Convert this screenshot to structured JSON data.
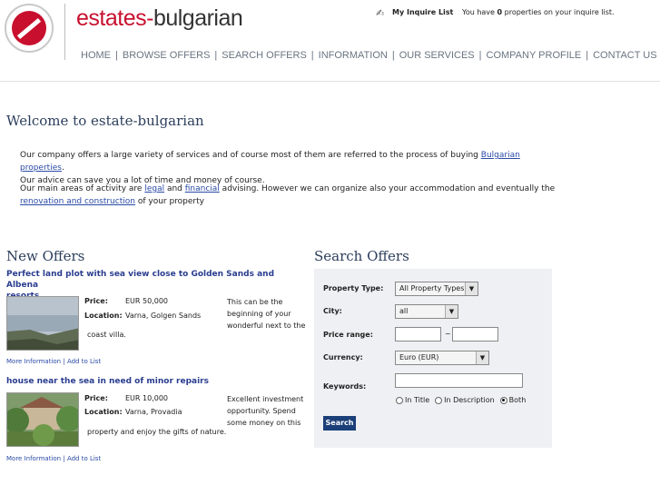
{
  "header": {
    "brand_part1": "estates-",
    "brand_part2": "bulgarian",
    "inquire_label": "My Inquire List",
    "inquire_text_before": "You have ",
    "inquire_count": "0",
    "inquire_text_after": " properties on your inquire list."
  },
  "nav": [
    "HOME",
    "BROWSE OFFERS",
    "SEARCH OFFERS",
    "INFORMATION",
    "OUR SERVICES",
    "COMPANY PROFILE",
    "CONTACT US"
  ],
  "welcome": {
    "title": "Welcome to estate-bulgarian",
    "p1_before": "Our company offers a large variety of services and of course most of them are referred to the process of buying ",
    "p1_link": "Bulgarian properties",
    "p1_after": ".",
    "p1_line2": "Our advice can save you a lot of time and money of course.",
    "p2_a": "Our main areas of activity are ",
    "p2_link1": "legal",
    "p2_b": " and ",
    "p2_link2": "financial",
    "p2_c": " advising. However we can organize also your accommodation and eventually the",
    "p2_link3": "renovation and construction",
    "p2_d": " of your property"
  },
  "new_offers": {
    "title": "New Offers",
    "offers": [
      {
        "title_line1": "Perfect land plot with sea view close to Golden Sands and Albena",
        "title_line2": "resorts",
        "price_label": "Price:",
        "price": "EUR 50,000",
        "location_label": "Location:",
        "location": "Varna, Golgen Sands",
        "desc1": "This can be the",
        "desc2": "beginning of your",
        "desc3": "wonderful next to the",
        "desc_cont": "coast villa.",
        "more": "More Information",
        "add": "Add to List"
      },
      {
        "title_line1": "house near the sea in need of minor repairs",
        "price_label": "Price:",
        "price": "EUR 10,000",
        "location_label": "Location:",
        "location": "Varna, Provadia",
        "desc1": "Excellent investment",
        "desc2": "opportunity. Spend",
        "desc3": "some money on this",
        "desc_cont": "property and enjoy the gifts of nature.",
        "more": "More Information",
        "add": "Add to List"
      }
    ],
    "link_separator": "|"
  },
  "search": {
    "title": "Search Offers",
    "property_type_label": "Property Type:",
    "property_type_value": "All Property Types",
    "city_label": "City:",
    "city_value": "all",
    "price_label": "Price range:",
    "price_separator": "~",
    "currency_label": "Currency:",
    "currency_value": "Euro (EUR)",
    "keywords_label": "Keywords:",
    "radio_in_title": "In Title",
    "radio_in_description": "In Description",
    "radio_both": "Both",
    "selected_radio": "Both",
    "button": "Search"
  },
  "colors": {
    "brand_red": "#c8102e",
    "title_blue": "#2c3e5c",
    "link_blue": "#2a4aa6",
    "panel_bg": "#eef0f4",
    "button_bg": "#1b3f78"
  },
  "icons": {
    "inquire": "pen-icon",
    "dropdown": "triangle-down"
  }
}
